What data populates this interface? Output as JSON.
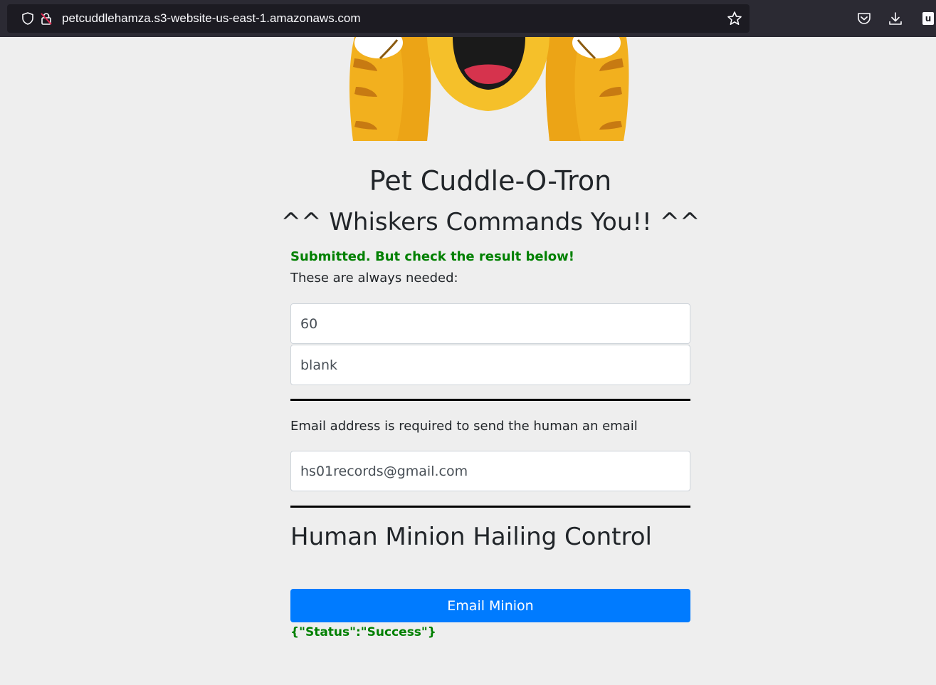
{
  "browser": {
    "url": "petcuddlehamza.s3-website-us-east-1.amazonaws.com",
    "extension_label": "u"
  },
  "page": {
    "title": "Pet Cuddle-O-Tron",
    "subtitle": "^^ Whiskers Commands You!! ^^",
    "submit_message": "Submitted. But check the result below!",
    "always_needed_label": "These are always needed:",
    "fields": {
      "wait_seconds_value": "60",
      "message_value": "blank",
      "email_value": "hs01records@gmail.com"
    },
    "email_label": "Email address is required to send the human an email",
    "section_title": "Human Minion Hailing Control",
    "email_button_label": "Email Minion",
    "result_text": "{\"Status\":\"Success\"}"
  },
  "colors": {
    "page_background": "#eeeeee",
    "success_green": "#008000",
    "button_blue": "#007bff",
    "browser_toolbar": "#2b2a33"
  },
  "icons": [
    "shield-icon",
    "lock-warning-icon",
    "bookmark-star-icon",
    "pocket-icon",
    "download-icon",
    "extension-icon",
    "cat-face-icon"
  ]
}
